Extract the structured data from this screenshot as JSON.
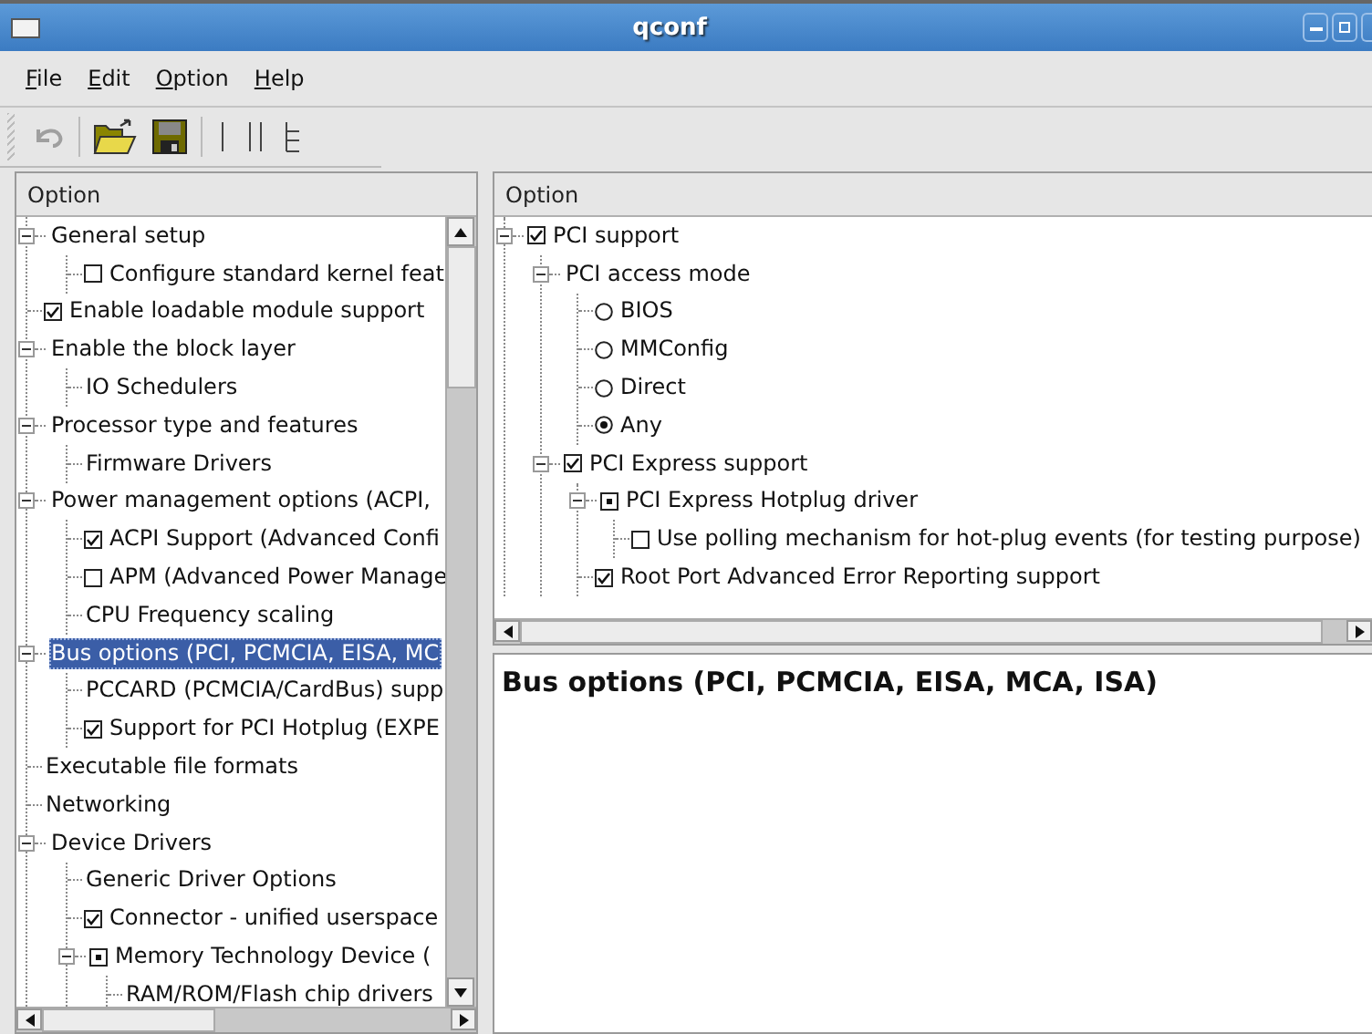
{
  "window": {
    "title": "qconf"
  },
  "menu": [
    "File",
    "Edit",
    "Option",
    "Help"
  ],
  "toolbar": [
    {
      "kind": "back",
      "disabled": true
    },
    {
      "kind": "load",
      "disabled": false
    },
    {
      "kind": "save",
      "disabled": false
    },
    {
      "kind": "single",
      "disabled": false
    },
    {
      "kind": "split",
      "disabled": false
    },
    {
      "kind": "full",
      "disabled": false
    }
  ],
  "config_tree": {
    "header": "Option",
    "items": [
      {
        "label": "General setup",
        "kind": "menu",
        "selected": false,
        "expanded": true,
        "children": [
          {
            "label": "Configure standard kernel feat",
            "kind": "bool",
            "checked": false,
            "selected": false
          }
        ]
      },
      {
        "label": "Enable loadable module support",
        "kind": "bool",
        "checked": true,
        "selected": false
      },
      {
        "label": "Enable the block layer",
        "kind": "menu",
        "selected": false,
        "expanded": true,
        "children": [
          {
            "label": "IO Schedulers",
            "kind": "menu",
            "selected": false
          }
        ]
      },
      {
        "label": "Processor type and features",
        "kind": "menu",
        "selected": false,
        "expanded": true,
        "children": [
          {
            "label": "Firmware Drivers",
            "kind": "menu",
            "selected": false
          }
        ]
      },
      {
        "label": "Power management options (ACPI,",
        "kind": "menu",
        "selected": false,
        "expanded": true,
        "children": [
          {
            "label": "ACPI Support (Advanced Confi",
            "kind": "bool",
            "checked": true,
            "selected": false
          },
          {
            "label": "APM (Advanced Power Manage",
            "kind": "bool",
            "checked": false,
            "selected": false
          },
          {
            "label": "CPU Frequency scaling",
            "kind": "menu",
            "selected": false
          }
        ]
      },
      {
        "label": "Bus options (PCI, PCMCIA, EISA, MC",
        "kind": "menu",
        "selected": true,
        "expanded": true,
        "children": [
          {
            "label": "PCCARD (PCMCIA/CardBus) supp",
            "kind": "menu",
            "selected": false
          },
          {
            "label": "Support for PCI Hotplug (EXPE",
            "kind": "bool",
            "checked": true,
            "selected": false
          }
        ]
      },
      {
        "label": "Executable file formats",
        "kind": "menu",
        "selected": false
      },
      {
        "label": "Networking",
        "kind": "menu",
        "selected": false
      },
      {
        "label": "Device Drivers",
        "kind": "menu",
        "selected": false,
        "expanded": true,
        "children": [
          {
            "label": "Generic Driver Options",
            "kind": "menu",
            "selected": false
          },
          {
            "label": "Connector - unified userspace",
            "kind": "bool",
            "checked": true,
            "selected": false
          },
          {
            "label": "Memory Technology Device (",
            "kind": "tristate",
            "module": true,
            "selected": false,
            "expanded": true,
            "children": [
              {
                "label": "RAM/ROM/Flash chip drivers",
                "kind": "menu",
                "selected": false
              }
            ]
          }
        ]
      }
    ]
  },
  "menu_tree": {
    "header": "Option",
    "items": [
      {
        "label": "PCI support",
        "kind": "bool",
        "checked": true,
        "selected": false,
        "expanded": true,
        "children": [
          {
            "label": "PCI access mode",
            "kind": "menu",
            "selected": false,
            "expanded": true,
            "children": [
              {
                "label": "BIOS",
                "kind": "radio",
                "checked": false,
                "selected": false
              },
              {
                "label": "MMConfig",
                "kind": "radio",
                "checked": false,
                "selected": false
              },
              {
                "label": "Direct",
                "kind": "radio",
                "checked": false,
                "selected": false
              },
              {
                "label": "Any",
                "kind": "radio",
                "checked": true,
                "selected": false
              }
            ]
          },
          {
            "label": "PCI Express support",
            "kind": "bool",
            "checked": true,
            "selected": false,
            "expanded": true,
            "children": [
              {
                "label": "PCI Express Hotplug driver",
                "kind": "tristate",
                "module": true,
                "selected": false,
                "expanded": true,
                "children": [
                  {
                    "label": "Use polling mechanism for hot-plug events (for testing purpose)",
                    "kind": "bool",
                    "checked": false,
                    "selected": false
                  }
                ]
              },
              {
                "label": "Root Port Advanced Error Reporting support",
                "kind": "bool",
                "checked": true,
                "selected": false
              }
            ]
          }
        ]
      }
    ]
  },
  "help": {
    "text": "Bus options (PCI, PCMCIA, EISA, MCA, ISA)"
  }
}
